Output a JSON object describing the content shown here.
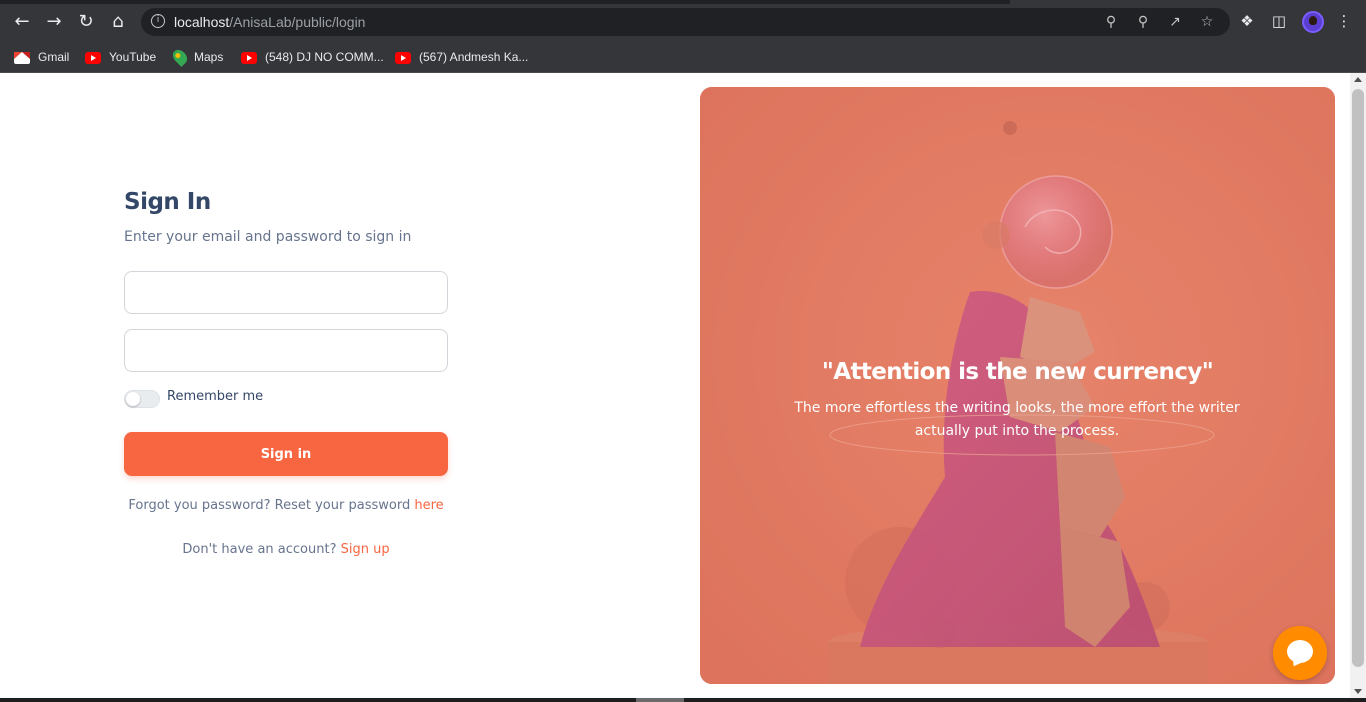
{
  "browser": {
    "url_host": "localhost",
    "url_path": "/AnisaLab/public/login",
    "bookmarks": [
      {
        "label": "Gmail",
        "icon": "gmail-icon"
      },
      {
        "label": "YouTube",
        "icon": "youtube-icon"
      },
      {
        "label": "Maps",
        "icon": "maps-icon"
      },
      {
        "label": "(548) DJ NO COMM...",
        "icon": "youtube-icon"
      },
      {
        "label": "(567) Andmesh Ka...",
        "icon": "youtube-icon"
      }
    ]
  },
  "signin": {
    "title": "Sign In",
    "subtitle": "Enter your email and password to sign in",
    "email_value": "",
    "password_value": "",
    "remember_label": "Remember me",
    "remember_checked": false,
    "button_label": "Sign in",
    "forgot_text": "Forgot you password? Reset your password ",
    "forgot_link": "here",
    "account_text": "Don't have an account? ",
    "signup_link": "Sign up"
  },
  "hero": {
    "quote": "\"Attention is the new currency\"",
    "text": "The more effortless the writing looks, the more effort the writer actually put into the process."
  },
  "colors": {
    "accent": "#f86541",
    "heading": "#344767",
    "muted": "#67748e",
    "hero_bg": "#e07a62",
    "chat": "#ff8c00"
  }
}
